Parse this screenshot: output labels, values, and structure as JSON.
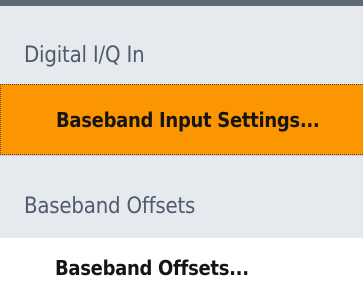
{
  "menu": {
    "sections": [
      {
        "title": "Digital I/Q In",
        "item": {
          "label": "Baseband Input Settings...",
          "selected": true
        }
      },
      {
        "title": "Baseband Offsets",
        "item": {
          "label": "Baseband Offsets...",
          "selected": false
        }
      }
    ]
  },
  "colors": {
    "header_bg": "#e6e9ee",
    "header_text": "#4e5b6d",
    "selected_bg": "#fb9600",
    "item_text": "#151515",
    "top_rule": "#5e6a78"
  }
}
